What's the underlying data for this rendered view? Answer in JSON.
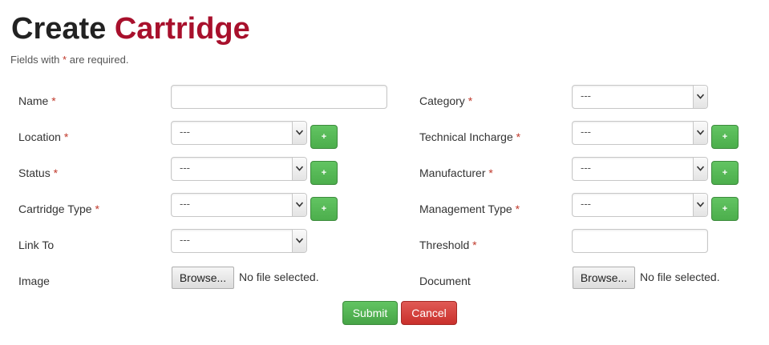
{
  "page": {
    "title_part1": "Create",
    "title_part2": "Cartridge",
    "required_note_prefix": "Fields with",
    "required_star": "*",
    "required_note_suffix": "are required."
  },
  "fields": {
    "name": {
      "label": "Name",
      "value": ""
    },
    "category": {
      "label": "Category",
      "value": "---"
    },
    "location": {
      "label": "Location",
      "value": "---"
    },
    "technical_incharge": {
      "label": "Technical Incharge",
      "value": "---"
    },
    "status": {
      "label": "Status",
      "value": "---"
    },
    "manufacturer": {
      "label": "Manufacturer",
      "value": "---"
    },
    "cartridge_type": {
      "label": "Cartridge Type",
      "value": "---"
    },
    "management_type": {
      "label": "Management Type",
      "value": "---"
    },
    "link_to": {
      "label": "Link To",
      "value": "---"
    },
    "threshold": {
      "label": "Threshold",
      "value": ""
    },
    "image": {
      "label": "Image",
      "browse_label": "Browse...",
      "status": "No file selected."
    },
    "document": {
      "label": "Document",
      "browse_label": "Browse...",
      "status": "No file selected."
    }
  },
  "add_button_label": "+",
  "actions": {
    "submit": "Submit",
    "cancel": "Cancel"
  },
  "colors": {
    "accent": "#a8102c",
    "success": "#5cb85c",
    "danger": "#d9534f"
  }
}
